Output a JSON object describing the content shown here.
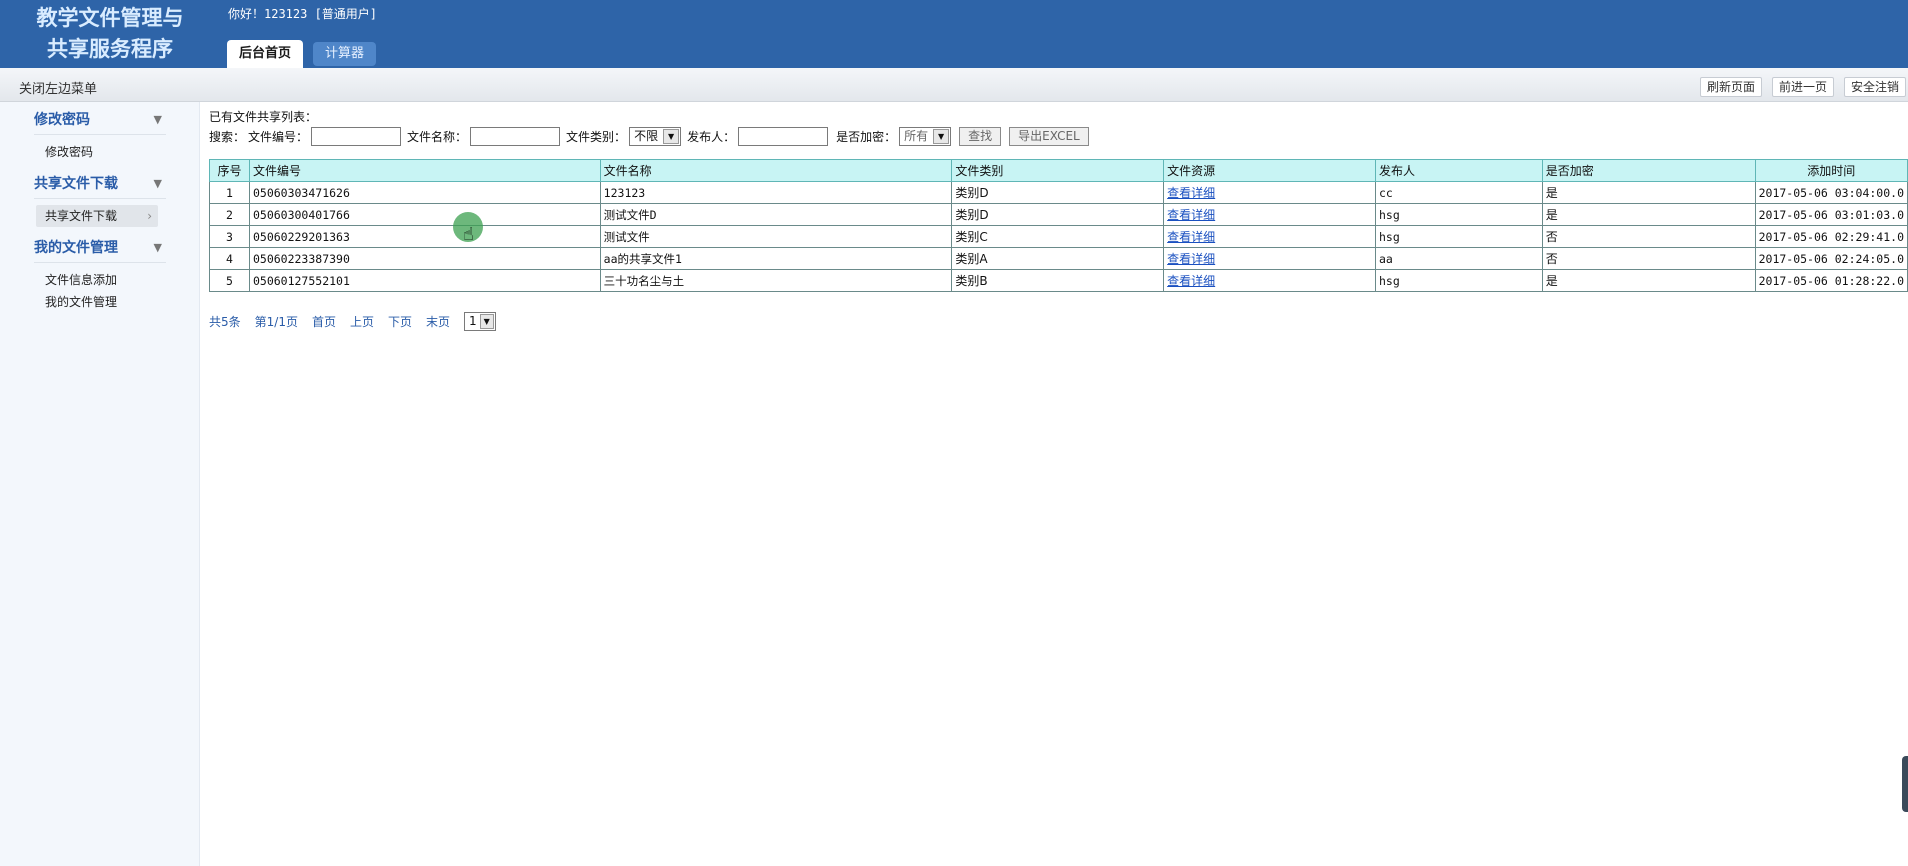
{
  "header": {
    "brand_line1": "教学文件管理与",
    "brand_line2": "共享服务程序",
    "greeting": "你好！123123 [普通用户]",
    "tabs": [
      {
        "label": "后台首页",
        "active": true
      },
      {
        "label": "计算器",
        "active": false
      }
    ]
  },
  "toolbar": {
    "toggle_menu": "关闭左边菜单",
    "refresh": "刷新页面",
    "forward": "前进一页",
    "logout": "安全注销"
  },
  "sidebar": {
    "groups": [
      {
        "title": "修改密码",
        "items": [
          "修改密码"
        ]
      },
      {
        "title": "共享文件下载",
        "items": [
          "共享文件下载"
        ],
        "selected": 0
      },
      {
        "title": "我的文件管理",
        "items": [
          "文件信息添加",
          "我的文件管理"
        ]
      }
    ]
  },
  "main": {
    "caption": "已有文件共享列表：",
    "search": {
      "label_search": "搜索：",
      "label_code": "文件编号：",
      "code_value": "",
      "label_name": "文件名称：",
      "name_value": "",
      "label_type": "文件类别：",
      "type_value": "不限",
      "label_publisher": "发布人：",
      "publisher_value": "",
      "label_encrypted": "是否加密：",
      "encrypted_value": "所有",
      "find_button": "查找",
      "export_button": "导出EXCEL"
    },
    "table": {
      "headers": [
        "序号",
        "文件编号",
        "文件名称",
        "文件类别",
        "文件资源",
        "发布人",
        "是否加密",
        "添加时间"
      ],
      "rows": [
        [
          "1",
          "05060303471626",
          "123123",
          "类别D",
          "查看详细",
          "cc",
          "是",
          "2017-05-06 03:04:00.0"
        ],
        [
          "2",
          "05060300401766",
          "测试文件D",
          "类别D",
          "查看详细",
          "hsg",
          "是",
          "2017-05-06 03:01:03.0"
        ],
        [
          "3",
          "05060229201363",
          "测试文件",
          "类别C",
          "查看详细",
          "hsg",
          "否",
          "2017-05-06 02:29:41.0"
        ],
        [
          "4",
          "05060223387390",
          "aa的共享文件1",
          "类别A",
          "查看详细",
          "aa",
          "否",
          "2017-05-06 02:24:05.0"
        ],
        [
          "5",
          "05060127552101",
          "三十功名尘与土",
          "类别B",
          "查看详细",
          "hsg",
          "是",
          "2017-05-06 01:28:22.0"
        ]
      ]
    },
    "pager": {
      "total": "共5条",
      "page": "第1/1页",
      "first": "首页",
      "prev": "上页",
      "next": "下页",
      "last": "末页",
      "select_value": "1"
    }
  },
  "colors": {
    "header_bg": "#2e64a8",
    "brand_text": "#d9ecff",
    "table_header_bg": "#c8f4f4",
    "link": "#1a50c0"
  },
  "icons": {
    "menu_arrow": "triangle-down-icon",
    "selected_chevron": "chevron-right-icon",
    "select_dropdown": "caret-down-icon",
    "cursor": "hand-pointer-icon"
  }
}
